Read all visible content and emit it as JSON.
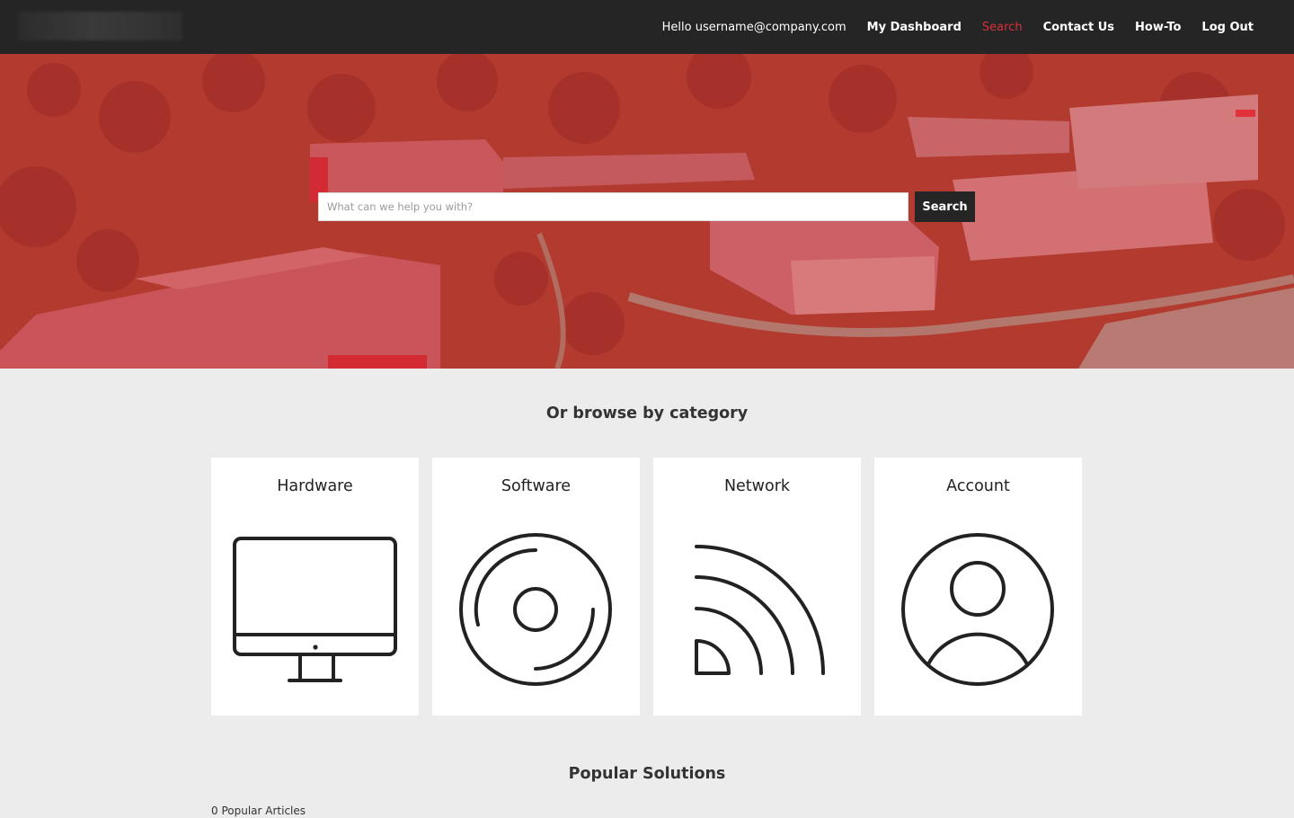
{
  "nav": {
    "greeting": "Hello username@company.com",
    "links": [
      "My Dashboard",
      "Search",
      "Contact Us",
      "How-To",
      "Log Out"
    ],
    "active": "Search"
  },
  "search": {
    "placeholder": "What can we help you with?",
    "button_label": "Search"
  },
  "browse": {
    "title": "Or browse by category",
    "categories": [
      {
        "label": "Hardware",
        "icon": "monitor-icon"
      },
      {
        "label": "Software",
        "icon": "disc-icon"
      },
      {
        "label": "Network",
        "icon": "signal-icon"
      },
      {
        "label": "Account",
        "icon": "user-circle-icon"
      }
    ]
  },
  "popular": {
    "title": "Popular Solutions",
    "count_text": "0 Popular Articles"
  },
  "colors": {
    "topbar": "#252525",
    "accent": "#d6303b",
    "hero_overlay": "#c42a34",
    "page_bg": "#ececec"
  }
}
